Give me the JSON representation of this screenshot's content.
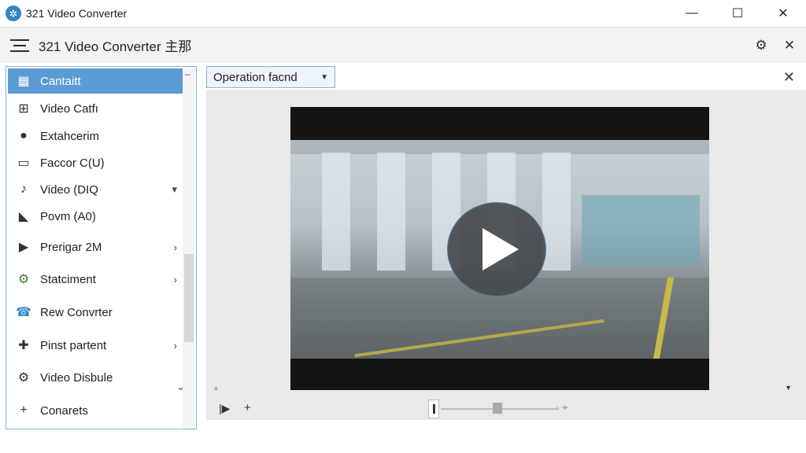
{
  "window": {
    "title": "321 Video Converter",
    "controls": {
      "minimize": "—",
      "maximize": "☐",
      "close": "✕"
    }
  },
  "header": {
    "title": "321 Video Converter 主那"
  },
  "sidebar": {
    "items": [
      {
        "label": "Cantaitt",
        "icon": "grid-icon",
        "active": true
      },
      {
        "label": "Video Catfı",
        "icon": "video-grid-icon"
      },
      {
        "label": "Extahcerim",
        "icon": "info-icon"
      },
      {
        "label": "Faccor C(U)",
        "icon": "window-icon"
      },
      {
        "label": "Video (DIQ",
        "icon": "mic-icon"
      },
      {
        "label": "Povm (A0)",
        "icon": "media-icon"
      },
      {
        "label": "Prerigar 2M",
        "icon": "play-box-icon"
      },
      {
        "label": "Statciment",
        "icon": "gear-icon"
      },
      {
        "label": "Rew Convrter",
        "icon": "phone-icon"
      },
      {
        "label": "Pinst partent",
        "icon": "plus-bold-icon"
      },
      {
        "label": "Video Disbule",
        "icon": "gear-icon"
      },
      {
        "label": "Conarets",
        "icon": "plus-icon"
      }
    ]
  },
  "main": {
    "operation_select": "Operation facnd",
    "video": {
      "state": "paused"
    }
  },
  "colors": {
    "accent": "#5a9bd5",
    "border": "#7fb3dd",
    "logo": "#2f86c6"
  }
}
